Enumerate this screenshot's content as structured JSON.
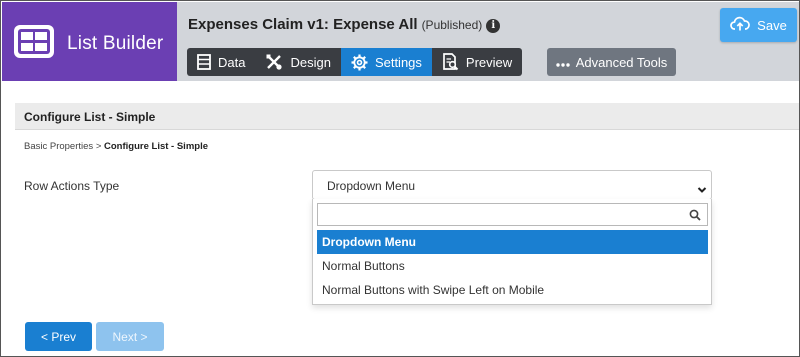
{
  "app": {
    "name": "List Builder",
    "logo_icon": "grid-icon",
    "brand_color": "#6b3fb3"
  },
  "header": {
    "title": "Expenses Claim v1: Expense All",
    "status": "(Published)",
    "info_icon_glyph": "i",
    "tabs": [
      {
        "label": "Data",
        "icon": "table-icon",
        "active": false
      },
      {
        "label": "Design",
        "icon": "design-tools-icon",
        "active": false
      },
      {
        "label": "Settings",
        "icon": "gear-icon",
        "active": true
      },
      {
        "label": "Preview",
        "icon": "document-search-icon",
        "active": false
      }
    ],
    "advanced_tools": {
      "label": "Advanced Tools",
      "icon": "ellipsis-icon"
    },
    "save": {
      "label": "Save",
      "icon": "cloud-upload-icon"
    },
    "accent_color": "#1a7fd1"
  },
  "section": {
    "title": "Configure List - Simple"
  },
  "breadcrumb": {
    "parent": "Basic Properties",
    "separator": ">",
    "current": "Configure List - Simple"
  },
  "form": {
    "row_actions": {
      "label": "Row Actions Type",
      "value": "Dropdown Menu",
      "search_value": "",
      "options": [
        {
          "label": "Dropdown Menu",
          "selected": true
        },
        {
          "label": "Normal Buttons",
          "selected": false
        },
        {
          "label": "Normal Buttons with Swipe Left on Mobile",
          "selected": false
        }
      ]
    }
  },
  "footer": {
    "prev_label": "< Prev",
    "next_label": "Next >",
    "next_disabled": true
  }
}
